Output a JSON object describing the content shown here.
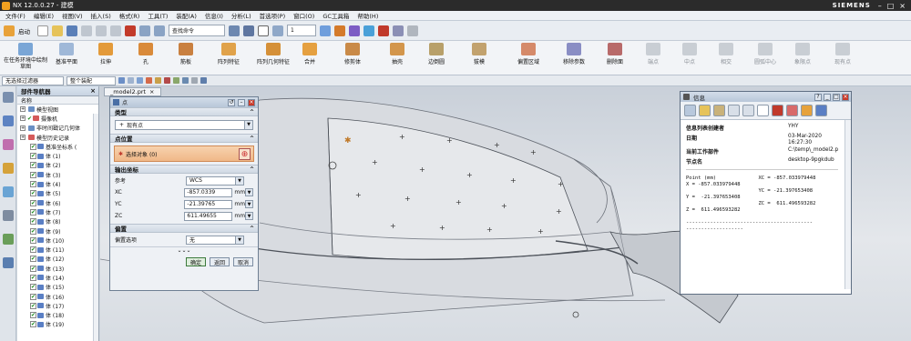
{
  "window": {
    "title": "NX 12.0.0.27 - 建模",
    "brand": "SIEMENS"
  },
  "menu": [
    "文件(F)",
    "编辑(E)",
    "视图(V)",
    "插入(S)",
    "格式(R)",
    "工具(T)",
    "装配(A)",
    "信息(I)",
    "分析(L)",
    "首选项(P)",
    "窗口(O)",
    "GC工具箱",
    "帮助(H)"
  ],
  "toolbar": {
    "start_label": "启动",
    "search_placeholder": "查找命令",
    "layer_value": "1"
  },
  "ribbon": {
    "buttons": [
      {
        "label": "在任务环境中绘制草图",
        "enabled": true
      },
      {
        "label": "基准平面",
        "enabled": true
      },
      {
        "label": "拉伸",
        "enabled": true
      },
      {
        "label": "孔",
        "enabled": true
      },
      {
        "label": "筋板",
        "enabled": true
      },
      {
        "label": "阵列特征",
        "enabled": true
      },
      {
        "label": "阵列几何特征",
        "enabled": true
      },
      {
        "label": "合并",
        "enabled": true
      },
      {
        "label": "修剪体",
        "enabled": true
      },
      {
        "label": "抽壳",
        "enabled": true
      },
      {
        "label": "边倒圆",
        "enabled": true
      },
      {
        "label": "拔模",
        "enabled": true
      },
      {
        "label": "偏置区域",
        "enabled": true
      },
      {
        "label": "移除参数",
        "enabled": true
      },
      {
        "label": "删除面",
        "enabled": true
      },
      {
        "label": "端点",
        "enabled": false
      },
      {
        "label": "中点",
        "enabled": false
      },
      {
        "label": "相交",
        "enabled": false
      },
      {
        "label": "圆弧中心",
        "enabled": false
      },
      {
        "label": "象限点",
        "enabled": false
      },
      {
        "label": "现有点",
        "enabled": false
      }
    ]
  },
  "selection_bar": {
    "filter": "无选择过滤器",
    "scope": "整个装配"
  },
  "navigator": {
    "title": "部件导航器",
    "column": "名称",
    "items": [
      {
        "label": "模型视图",
        "level": 0,
        "check": false
      },
      {
        "label": "摄像机",
        "level": 0,
        "check": true
      },
      {
        "label": "非时间戳记几何体",
        "level": 0,
        "check": false
      },
      {
        "label": "模型历史记录",
        "level": 0,
        "check": false
      },
      {
        "label": "基准坐标系 (",
        "level": 1,
        "check": true
      },
      {
        "label": "体 (1)",
        "level": 1,
        "check": true
      },
      {
        "label": "体 (2)",
        "level": 1,
        "check": true
      },
      {
        "label": "体 (3)",
        "level": 1,
        "check": true
      },
      {
        "label": "体 (4)",
        "level": 1,
        "check": true
      },
      {
        "label": "体 (5)",
        "level": 1,
        "check": true
      },
      {
        "label": "体 (6)",
        "level": 1,
        "check": true
      },
      {
        "label": "体 (7)",
        "level": 1,
        "check": true
      },
      {
        "label": "体 (8)",
        "level": 1,
        "check": true
      },
      {
        "label": "体 (9)",
        "level": 1,
        "check": true
      },
      {
        "label": "体 (10)",
        "level": 1,
        "check": true
      },
      {
        "label": "体 (11)",
        "level": 1,
        "check": true
      },
      {
        "label": "体 (12)",
        "level": 1,
        "check": true
      },
      {
        "label": "体 (13)",
        "level": 1,
        "check": true
      },
      {
        "label": "体 (14)",
        "level": 1,
        "check": true
      },
      {
        "label": "体 (15)",
        "level": 1,
        "check": true
      },
      {
        "label": "体 (16)",
        "level": 1,
        "check": true
      },
      {
        "label": "体 (17)",
        "level": 1,
        "check": true
      },
      {
        "label": "体 (18)",
        "level": 1,
        "check": true
      },
      {
        "label": "体 (19)",
        "level": 1,
        "check": true
      }
    ]
  },
  "viewport": {
    "tab": "_model2.prt"
  },
  "point_dialog": {
    "title": "点",
    "type_section": "类型",
    "type_value": "现有点",
    "location_section": "点位置",
    "select_label": "选择对象 (0)",
    "output_section": "输出坐标",
    "ref_label": "参考",
    "ref_value": "WCS",
    "xc_label": "XC",
    "xc_value": "-857.0339",
    "yc_label": "YC",
    "yc_value": "-21.39765",
    "zc_label": "ZC",
    "zc_value": "611.49655",
    "unit": "mm",
    "offset_section": "偏置",
    "offset_label": "偏置选项",
    "offset_value": "无",
    "ok": "确定",
    "back": "返回",
    "cancel": "取消"
  },
  "info_window": {
    "title": "信息",
    "creator_label": "信息列表创建者",
    "creator_value": "YHY",
    "date_label": "日期",
    "date_value": "03-Mar-2020\n16:27:30",
    "part_label": "当前工作部件",
    "part_value": "C:\\temp\\_model2.p",
    "node_label": "节点名",
    "node_value": "desktop-9pgkdub",
    "point_text": "Point (mm)              XC = -857.033979448\nX = -857.033979448\n                        YC = -21.397653408\nY =  -21.397653408\n                        ZC =  611.496593282\nZ =  611.496593282\n\n------------------------------------------\n-------------------"
  }
}
